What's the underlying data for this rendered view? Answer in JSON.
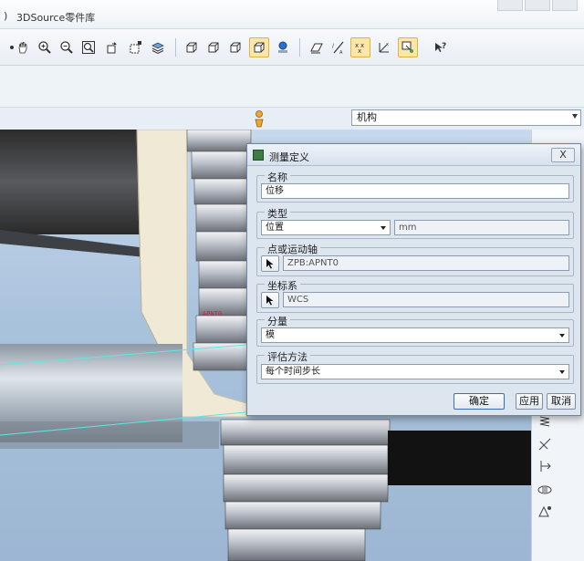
{
  "menubar": {
    "left_fragment": ")",
    "menu_item": "3DSource零件库"
  },
  "toolbar": {
    "icons": [
      "pan-icon",
      "zoom-in-icon",
      "zoom-out-icon",
      "zoom-fit-icon",
      "orient-icon",
      "view-manager-icon",
      "layers-icon",
      "shade-edges-icon",
      "shade-icon",
      "hidden-line-icon",
      "wireframe-icon",
      "shading-icon",
      "datum-plane-icon",
      "datum-axis-icon",
      "datum-point-icon",
      "coord-sys-icon",
      "spin-center-icon",
      "help-icon"
    ]
  },
  "mechanism_select": {
    "value": "机构"
  },
  "dialog": {
    "title": "测量定义",
    "close_label": "X",
    "name": {
      "legend": "名称",
      "value": "位移"
    },
    "type": {
      "legend": "类型",
      "value": "位置",
      "unit": "mm"
    },
    "point_axis": {
      "legend": "点或运动轴",
      "value": "ZPB:APNT0"
    },
    "coord_sys": {
      "legend": "坐标系",
      "value": "WCS"
    },
    "component": {
      "legend": "分量",
      "value": "模"
    },
    "eval_method": {
      "legend": "评估方法",
      "value": "每个时间步长"
    },
    "buttons": {
      "ok": "确定",
      "apply": "应用",
      "cancel": "取消"
    }
  },
  "viewport": {
    "point_label": "APNT0"
  },
  "colors": {
    "accent": "#3b6fb3",
    "gear": "#b8bcc4",
    "highlight": "#fde7a8"
  }
}
